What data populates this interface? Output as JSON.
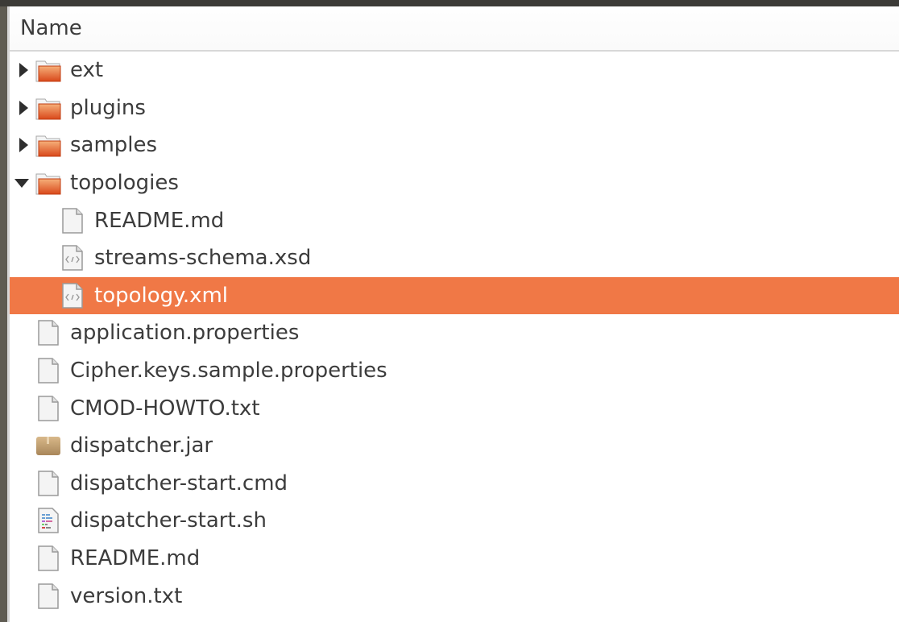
{
  "header": {
    "name_column": "Name"
  },
  "colors": {
    "selection": "#f07846",
    "folder": "#e0602a"
  },
  "items": [
    {
      "label": "ext",
      "type": "folder",
      "icon": "folder-icon",
      "level": 0,
      "expander": "collapsed"
    },
    {
      "label": "plugins",
      "type": "folder",
      "icon": "folder-icon",
      "level": 0,
      "expander": "collapsed"
    },
    {
      "label": "samples",
      "type": "folder",
      "icon": "folder-icon",
      "level": 0,
      "expander": "collapsed"
    },
    {
      "label": "topologies",
      "type": "folder",
      "icon": "folder-icon",
      "level": 0,
      "expander": "expanded"
    },
    {
      "label": "README.md",
      "type": "file",
      "icon": "text-file-icon",
      "level": 1
    },
    {
      "label": "streams-schema.xsd",
      "type": "file",
      "icon": "xml-file-icon",
      "level": 1
    },
    {
      "label": "topology.xml",
      "type": "file",
      "icon": "xml-file-icon",
      "level": 1,
      "selected": true
    },
    {
      "label": "application.properties",
      "type": "file",
      "icon": "text-file-icon",
      "level": 0
    },
    {
      "label": "Cipher.keys.sample.properties",
      "type": "file",
      "icon": "text-file-icon",
      "level": 0
    },
    {
      "label": "CMOD-HOWTO.txt",
      "type": "file",
      "icon": "text-file-icon",
      "level": 0
    },
    {
      "label": "dispatcher.jar",
      "type": "file",
      "icon": "archive-icon",
      "level": 0
    },
    {
      "label": "dispatcher-start.cmd",
      "type": "file",
      "icon": "text-file-icon",
      "level": 0
    },
    {
      "label": "dispatcher-start.sh",
      "type": "file",
      "icon": "script-file-icon",
      "level": 0
    },
    {
      "label": "README.md",
      "type": "file",
      "icon": "text-file-icon",
      "level": 0
    },
    {
      "label": "version.txt",
      "type": "file",
      "icon": "text-file-icon",
      "level": 0
    }
  ]
}
